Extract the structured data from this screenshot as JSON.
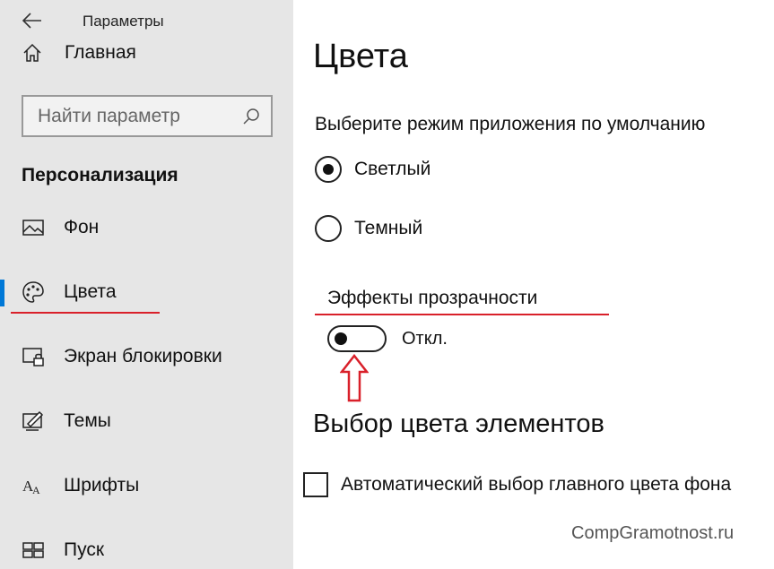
{
  "window": {
    "title": "Параметры"
  },
  "sidebar": {
    "home_label": "Главная",
    "search_placeholder": "Найти параметр",
    "section_title": "Персонализация",
    "items": [
      {
        "label": "Фон",
        "icon": "picture-icon"
      },
      {
        "label": "Цвета",
        "icon": "palette-icon",
        "active": true
      },
      {
        "label": "Экран блокировки",
        "icon": "lock-screen-icon"
      },
      {
        "label": "Темы",
        "icon": "themes-icon"
      },
      {
        "label": "Шрифты",
        "icon": "fonts-icon"
      },
      {
        "label": "Пуск",
        "icon": "start-icon"
      }
    ]
  },
  "main": {
    "title": "Цвета",
    "mode_label": "Выберите режим приложения по умолчанию",
    "mode_options": [
      {
        "label": "Светлый",
        "checked": true
      },
      {
        "label": "Темный",
        "checked": false
      }
    ],
    "transparency_label": "Эффекты прозрачности",
    "transparency_state": "Откл.",
    "accent_title": "Выбор цвета элементов",
    "auto_accent_label": "Автоматический выбор главного цвета фона",
    "auto_accent_checked": false
  },
  "watermark": "CompGramotnost.ru",
  "colors": {
    "sidebar_bg": "#e6e6e6",
    "accent": "#0078d7",
    "annotation_red": "#d9202a"
  }
}
